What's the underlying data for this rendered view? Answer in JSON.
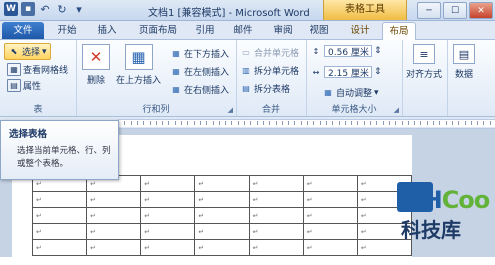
{
  "titlebar": {
    "title": "文档1 [兼容模式] - Microsoft Word",
    "context_tab_group": "表格工具"
  },
  "tabs": [
    "文件",
    "开始",
    "插入",
    "页面布局",
    "引用",
    "邮件",
    "审阅",
    "视图",
    "设计",
    "布局"
  ],
  "active_tab": "布局",
  "ribbon": {
    "table_group": {
      "label": "表",
      "select": "选择",
      "gridlines": "查看网格线",
      "properties": "属性"
    },
    "rows_cols_group": {
      "label": "行和列",
      "delete": "删除",
      "insert_above": "在上方插入",
      "insert_below": "在下方插入",
      "insert_left": "在左侧插入",
      "insert_right": "在右侧插入"
    },
    "merge_group": {
      "label": "合并",
      "merge_cells": "合并单元格",
      "split_cells": "拆分单元格",
      "split_table": "拆分表格"
    },
    "cell_size_group": {
      "label": "单元格大小",
      "height": "0.56 厘米",
      "width": "2.15 厘米",
      "autofit": "自动调整"
    },
    "alignment": "对齐方式",
    "data": "数据"
  },
  "tooltip": {
    "title": "选择表格",
    "description": "选择当前单元格、行、列或整个表格。"
  },
  "table": {
    "cell_mark": "↵",
    "rows": 5,
    "cols": 7
  },
  "watermark": {
    "brand": "KHCoo",
    "cn": "科技库"
  },
  "colors": {
    "file_tab": "#1e59a8",
    "context_tab": "#f0bd44",
    "ribbon_bg": "#dfe9f6",
    "doc_bg": "#c6d3e4"
  }
}
